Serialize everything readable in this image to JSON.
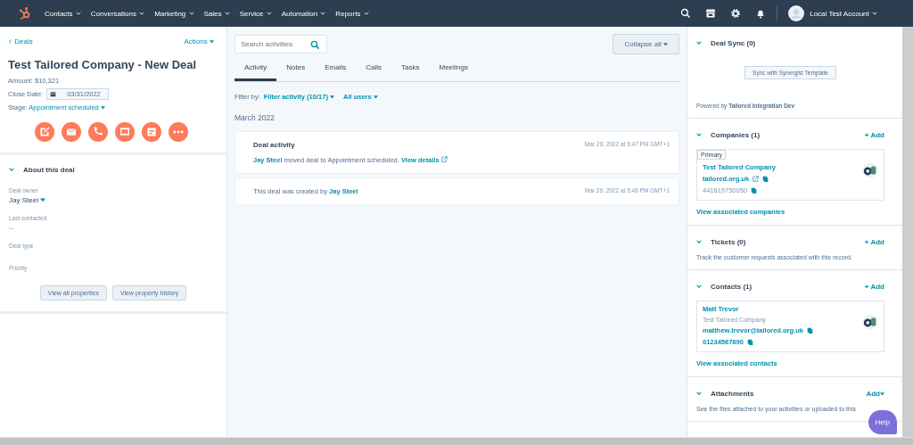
{
  "nav": {
    "items": [
      "Contacts",
      "Conversations",
      "Marketing",
      "Sales",
      "Service",
      "Automation",
      "Reports"
    ],
    "account": "Local Test Account"
  },
  "deal": {
    "back": "Deals",
    "actions": "Actions",
    "title": "Test Tailored Company - New Deal",
    "amount_label": "Amount:",
    "amount": "$10,321",
    "close_label": "Close Date:",
    "close_date": "03/31/2022",
    "stage_label": "Stage:",
    "stage": "Appointment scheduled",
    "action_buttons": [
      {
        "kind": "note"
      },
      {
        "kind": "email"
      },
      {
        "kind": "call"
      },
      {
        "kind": "meeting"
      },
      {
        "kind": "task"
      },
      {
        "kind": "more"
      }
    ]
  },
  "about": {
    "title": "About this deal",
    "expanded": true,
    "fields": [
      {
        "label": "Deal owner",
        "value": "Jay Steel",
        "kind": "select"
      },
      {
        "label": "Last contacted",
        "value": "--",
        "kind": "text"
      },
      {
        "label": "Deal type",
        "kind": "text"
      },
      {
        "label": "Priority",
        "kind": "text"
      }
    ],
    "buttons": [
      "View all properties",
      "View property history"
    ]
  },
  "activity": {
    "search": {
      "placeholder": "Search activities"
    },
    "collapse": "Collapse all",
    "tabs": [
      {
        "label": "Activity",
        "selected": true
      },
      {
        "label": "Notes",
        "selected": false
      },
      {
        "label": "Emails",
        "selected": false
      },
      {
        "label": "Calls",
        "selected": false
      },
      {
        "label": "Tasks",
        "selected": false
      },
      {
        "label": "Meetings",
        "selected": false
      }
    ],
    "filter_label": "Filter by:",
    "filter": "Filter activity (10/17)",
    "users": "All users",
    "month": "March 2022",
    "items": [
      {
        "title": "Deal activity",
        "parts": [
          {
            "kind": "link",
            "text": "Jay Steel"
          },
          {
            "kind": "plain",
            "text": "moved deal to Appointment scheduled."
          }
        ],
        "link": "View details",
        "time": "Mar 29, 2022 at 5:47 PM GMT+1"
      },
      {
        "parts": [
          {
            "kind": "plain",
            "text": "This deal was created by"
          },
          {
            "kind": "link",
            "text": "Jay Steel"
          }
        ],
        "time": "Mar 29, 2022 at 5:46 PM GMT+1"
      }
    ]
  },
  "sidebar": {
    "deal_sync": {
      "title": "Deal Sync (0)",
      "expanded": true,
      "button": "Sync with Synergist Template",
      "powered_label": "Powered by",
      "powered": "Tailored Integration Dev"
    },
    "companies": {
      "title": "Companies (1)",
      "expanded": true,
      "add": "+ Add",
      "tag": "Primary",
      "name": "Test Tailored Company",
      "domain": "tailored.org.uk",
      "phone": "441619750050",
      "view": "View associated companies"
    },
    "tickets": {
      "title": "Tickets (0)",
      "expanded": true,
      "add": "+ Add",
      "text": "Track the customer requests associated with this record."
    },
    "contacts": {
      "title": "Contacts (1)",
      "expanded": true,
      "add": "+ Add",
      "name": "Matt Trevor",
      "company": "Test Tailored Company",
      "email": "matthew.trevor@tailored.org.uk",
      "phone": "01234567890",
      "view": "View associated contacts"
    },
    "attachments": {
      "title": "Attachments",
      "expanded": true,
      "add": "Add",
      "text": "See the files attached to your activities or uploaded to this"
    }
  },
  "help": "Help"
}
